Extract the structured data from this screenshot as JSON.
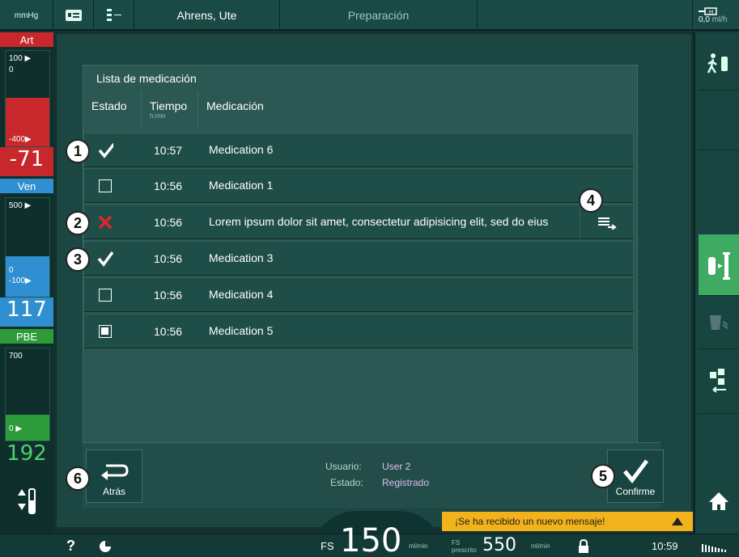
{
  "topbar": {
    "unit": "mmHg",
    "patient": "Ahrens, Ute",
    "phase": "Preparación",
    "flow_value": "0,0",
    "flow_unit": "ml/h"
  },
  "left": {
    "art": {
      "label": "Art",
      "scale_top": "100",
      "scale_zero": "0",
      "scale_low": "-400",
      "value": "-71"
    },
    "ven": {
      "label": "Ven",
      "scale_top": "500",
      "scale_zero": "0",
      "scale_low": "-100",
      "value": "117"
    },
    "pbe": {
      "label": "PBE",
      "scale_top": "700",
      "scale_zero": "0",
      "value": "192"
    }
  },
  "list": {
    "title": "Lista de medicación",
    "headers": {
      "estado": "Estado",
      "tiempo": "Tiempo",
      "tiempo_unit": "h:min",
      "medicacion": "Medicación"
    },
    "rows": [
      {
        "status": "check",
        "time": "10:57",
        "name": "Medication 6"
      },
      {
        "status": "empty",
        "time": "10:56",
        "name": "Medication 1"
      },
      {
        "status": "cross",
        "time": "10:56",
        "name": "Lorem ipsum dolor sit amet, consectetur adipisicing elit, sed do eius"
      },
      {
        "status": "check-warn",
        "time": "10:56",
        "name": "Medication 3"
      },
      {
        "status": "empty",
        "time": "10:56",
        "name": "Medication 4"
      },
      {
        "status": "filled",
        "time": "10:56",
        "name": "Medication 5"
      }
    ]
  },
  "callouts": [
    "1",
    "2",
    "3",
    "4",
    "5",
    "6"
  ],
  "action": {
    "back_label": "Atrás",
    "confirm_label": "Confirme",
    "user_label": "Usuario:",
    "user_value": "User 2",
    "state_label": "Estado:",
    "state_value": "Registrado"
  },
  "message": "¡Se ha recibido un nuevo mensaje!",
  "bottombar": {
    "help": "?",
    "fs_label": "FS",
    "fs_value": "150",
    "fs_unit": "ml/min",
    "fs_pres_label1": "FS",
    "fs_pres_label2": "prescrito",
    "fs_pres_value": "550",
    "fs_pres_unit": "ml/min",
    "time": "10:59"
  },
  "colors": {
    "art": "#c8272c",
    "ven": "#2f8fd0",
    "pbe": "#2e9b3a",
    "accent": "#f2b21b",
    "active_green": "#3faa62"
  }
}
